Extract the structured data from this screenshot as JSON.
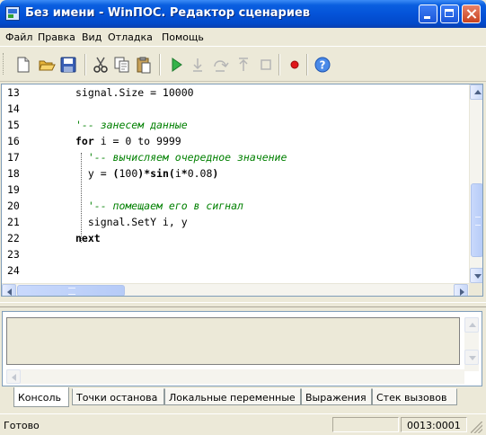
{
  "window": {
    "title": "Без имени - WinПОС. Редактор сценариев",
    "title_bar_color": "#0453d8"
  },
  "menu": {
    "items": [
      {
        "id": "file",
        "label": "Файл"
      },
      {
        "id": "edit",
        "label": "Правка"
      },
      {
        "id": "view",
        "label": "Вид"
      },
      {
        "id": "debug",
        "label": "Отладка"
      },
      {
        "id": "help",
        "label": "Помощь"
      }
    ]
  },
  "toolbar": {
    "buttons": [
      {
        "id": "new",
        "icon": "new-document-icon",
        "enabled": true
      },
      {
        "id": "open",
        "icon": "open-folder-icon",
        "enabled": true
      },
      {
        "id": "save",
        "icon": "save-disk-icon",
        "enabled": true
      },
      {
        "id": "cut",
        "icon": "scissors-icon",
        "enabled": true
      },
      {
        "id": "copy",
        "icon": "copy-icon",
        "enabled": true
      },
      {
        "id": "paste",
        "icon": "paste-icon",
        "enabled": true
      },
      {
        "id": "run",
        "icon": "play-icon",
        "enabled": true
      },
      {
        "id": "step-into",
        "icon": "step-into-icon",
        "enabled": false
      },
      {
        "id": "step-over",
        "icon": "step-over-icon",
        "enabled": false
      },
      {
        "id": "step-out",
        "icon": "step-out-icon",
        "enabled": false
      },
      {
        "id": "stop",
        "icon": "stop-icon",
        "enabled": false
      },
      {
        "id": "breakpoint",
        "icon": "breakpoint-icon",
        "enabled": true
      },
      {
        "id": "help",
        "icon": "help-icon",
        "enabled": true
      }
    ]
  },
  "editor": {
    "lines": [
      {
        "num": "13",
        "code": [
          {
            "t": "signal.Size = 10000",
            "k": "plain"
          }
        ]
      },
      {
        "num": "14",
        "code": []
      },
      {
        "num": "15",
        "code": [
          {
            "t": "'-- занесем данные",
            "k": "comment"
          }
        ]
      },
      {
        "num": "16",
        "code": [
          {
            "t": "for",
            "k": "keyword"
          },
          {
            "t": " i = 0 to 9999",
            "k": "plain"
          }
        ]
      },
      {
        "num": "17",
        "code": [
          {
            "t": "  '-- вычисляем очередное значение",
            "k": "comment"
          }
        ]
      },
      {
        "num": "18",
        "code": [
          {
            "t": "  y = ",
            "k": "plain"
          },
          {
            "t": "(",
            "k": "keyword"
          },
          {
            "t": "100",
            "k": "plain"
          },
          {
            "t": ")*sin(",
            "k": "keyword"
          },
          {
            "t": "i",
            "k": "plain"
          },
          {
            "t": "*",
            "k": "keyword"
          },
          {
            "t": "0.08",
            "k": "plain"
          },
          {
            "t": ")",
            "k": "keyword"
          }
        ]
      },
      {
        "num": "19",
        "code": []
      },
      {
        "num": "20",
        "code": [
          {
            "t": "  '-- помещаем его в сигнал",
            "k": "comment"
          }
        ]
      },
      {
        "num": "21",
        "code": [
          {
            "t": "  signal.SetY i, y",
            "k": "plain"
          }
        ]
      },
      {
        "num": "22",
        "code": [
          {
            "t": "next",
            "k": "keyword"
          }
        ]
      },
      {
        "num": "23",
        "code": []
      },
      {
        "num": "24",
        "code": []
      }
    ],
    "comment_color": "#008000"
  },
  "tabs": [
    {
      "label": "Консоль",
      "active": true
    },
    {
      "label": "Точки останова",
      "active": false
    },
    {
      "label": "Локальные переменные",
      "active": false
    },
    {
      "label": "Выражения",
      "active": false
    },
    {
      "label": "Стек вызовов",
      "active": false
    }
  ],
  "status": {
    "text": "Готово",
    "position": "0013:0001"
  }
}
